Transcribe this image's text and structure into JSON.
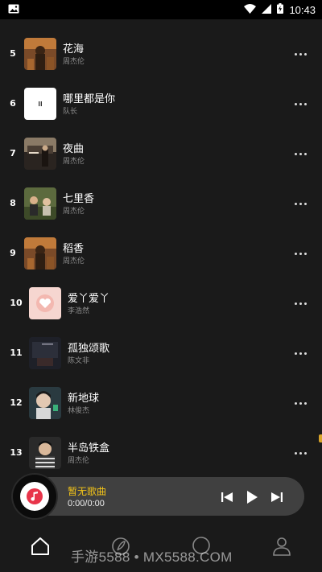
{
  "status_bar": {
    "time": "10:43",
    "icons": [
      "image-icon",
      "wifi-icon",
      "signal-icon",
      "battery-charging-icon"
    ]
  },
  "songs": [
    {
      "rank": "5",
      "title": "花海",
      "artist": "周杰伦",
      "cover": "cover-farm-art"
    },
    {
      "rank": "6",
      "title": "哪里都是你",
      "artist": "队长",
      "cover": "cover-white-pause"
    },
    {
      "rank": "7",
      "title": "夜曲",
      "artist": "周杰伦",
      "cover": "cover-night-street"
    },
    {
      "rank": "8",
      "title": "七里香",
      "artist": "周杰伦",
      "cover": "cover-garden"
    },
    {
      "rank": "9",
      "title": "稻香",
      "artist": "周杰伦",
      "cover": "cover-farm-art"
    },
    {
      "rank": "10",
      "title": "爱丫爱丫",
      "artist": "李浩然",
      "cover": "cover-pink-heart"
    },
    {
      "rank": "11",
      "title": "孤独颂歌",
      "artist": "陈文非",
      "cover": "cover-dark-room"
    },
    {
      "rank": "12",
      "title": "新地球",
      "artist": "林俊杰",
      "cover": "cover-portrait"
    },
    {
      "rank": "13",
      "title": "半岛铁盒",
      "artist": "周杰伦",
      "cover": "cover-portrait-stripes"
    }
  ],
  "player": {
    "title": "暂无歌曲",
    "time": "0:00/0:00",
    "disc_icon": "music-note-icon",
    "controls": [
      "previous-icon",
      "play-icon",
      "next-icon"
    ]
  },
  "bottom_nav": {
    "items": [
      "home-icon",
      "feather-icon",
      "chat-icon",
      "user-icon"
    ]
  },
  "watermark": "手游5588 • MX5588.COM",
  "colors": {
    "background": "#1a1a1a",
    "accent": "#f5c518",
    "player_bg": "#404040",
    "muted_text": "#8e8e8e"
  }
}
